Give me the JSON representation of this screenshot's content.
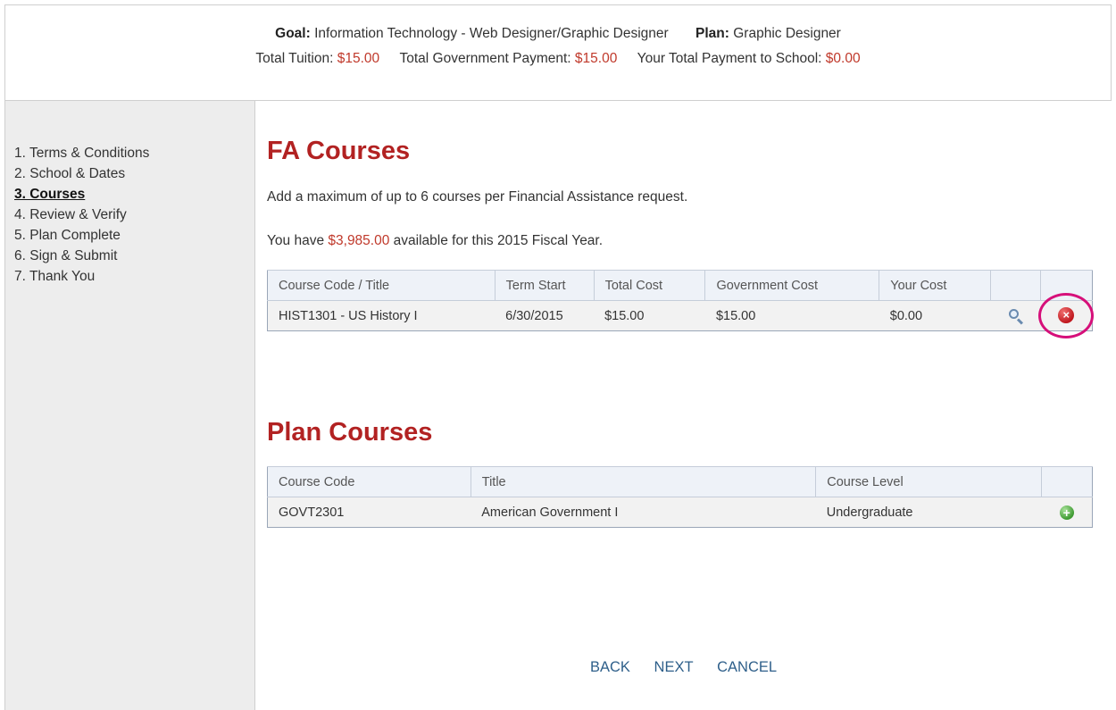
{
  "header": {
    "goal_label": "Goal:",
    "goal_value": "Information Technology - Web Designer/Graphic Designer",
    "plan_label": "Plan:",
    "plan_value": "Graphic Designer",
    "total_tuition_label": "Total Tuition:",
    "total_tuition_value": "$15.00",
    "total_gov_label": "Total Government Payment:",
    "total_gov_value": "$15.00",
    "your_total_label": "Your Total Payment to School:",
    "your_total_value": "$0.00"
  },
  "sidebar": {
    "steps": [
      {
        "label": "1. Terms & Conditions"
      },
      {
        "label": "2. School & Dates"
      },
      {
        "label": "3. Courses"
      },
      {
        "label": "4. Review & Verify"
      },
      {
        "label": "5. Plan Complete"
      },
      {
        "label": "6. Sign & Submit"
      },
      {
        "label": "7. Thank You"
      }
    ]
  },
  "fa_courses": {
    "title": "FA Courses",
    "max_text": "Add a maximum of up to 6 courses per Financial Assistance request.",
    "available_prefix": "You have",
    "available_amount": "$3,985.00",
    "available_suffix": "available for this 2015 Fiscal Year.",
    "columns": [
      "Course Code / Title",
      "Term Start",
      "Total Cost",
      "Government Cost",
      "Your Cost"
    ],
    "rows": [
      {
        "course": "HIST1301 - US History I",
        "term_start": "6/30/2015",
        "total_cost": "$15.00",
        "gov_cost": "$15.00",
        "your_cost": "$0.00"
      }
    ]
  },
  "plan_courses": {
    "title": "Plan Courses",
    "columns": [
      "Course Code",
      "Title",
      "Course Level"
    ],
    "rows": [
      {
        "code": "GOVT2301",
        "title": "American Government I",
        "level": "Undergraduate"
      }
    ]
  },
  "nav": {
    "back": "BACK",
    "next": "NEXT",
    "cancel": "CANCEL"
  },
  "colors": {
    "accent_red": "#b22222",
    "money": "#c0392b",
    "link": "#2e5f8a",
    "highlight_ring": "#d6107a"
  },
  "icons": {
    "view": "magnifier-icon",
    "delete": "delete-icon",
    "add": "add-icon"
  }
}
